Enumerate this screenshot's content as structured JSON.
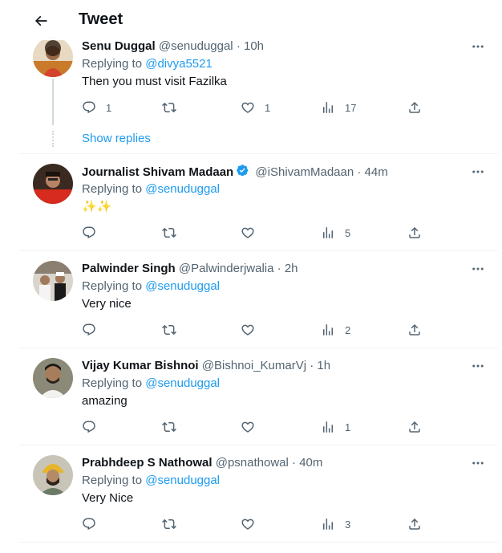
{
  "header": {
    "title": "Tweet"
  },
  "show_replies_label": "Show replies",
  "tweets": [
    {
      "name": "Senu Duggal",
      "handle": "@senuduggal",
      "time": "10h",
      "replying_label": "Replying to",
      "replying_to": "@divya5521",
      "text": "Then you must visit Fazilka",
      "replies": "1",
      "retweets": "",
      "likes": "1",
      "views": "17",
      "verified": false
    },
    {
      "name": "Journalist Shivam Madaan",
      "handle": "@iShivamMadaan",
      "time": "44m",
      "replying_label": "Replying to",
      "replying_to": "@senuduggal",
      "text": "✨✨",
      "replies": "",
      "retweets": "",
      "likes": "",
      "views": "5",
      "verified": true
    },
    {
      "name": "Palwinder Singh",
      "handle": "@Palwinderjwalia",
      "time": "2h",
      "replying_label": "Replying to",
      "replying_to": "@senuduggal",
      "text": "Very nice",
      "replies": "",
      "retweets": "",
      "likes": "",
      "views": "2",
      "verified": false
    },
    {
      "name": "Vijay Kumar Bishnoi",
      "handle": "@Bishnoi_KumarVj",
      "time": "1h",
      "replying_label": "Replying to",
      "replying_to": "@senuduggal",
      "text": "amazing",
      "replies": "",
      "retweets": "",
      "likes": "",
      "views": "1",
      "verified": false
    },
    {
      "name": "Prabhdeep S Nathowal",
      "handle": "@psnathowal",
      "time": "40m",
      "replying_label": "Replying to",
      "replying_to": "@senuduggal",
      "text": "Very Nice",
      "replies": "",
      "retweets": "",
      "likes": "",
      "views": "3",
      "verified": false
    }
  ],
  "colors": {
    "accent": "#1d9bf0",
    "muted": "#536471",
    "text": "#0f1419",
    "divider": "#eff3f4"
  },
  "icons": [
    "back-arrow-icon",
    "more-icon",
    "reply-icon",
    "retweet-icon",
    "like-icon",
    "views-icon",
    "share-icon",
    "verified-icon"
  ]
}
